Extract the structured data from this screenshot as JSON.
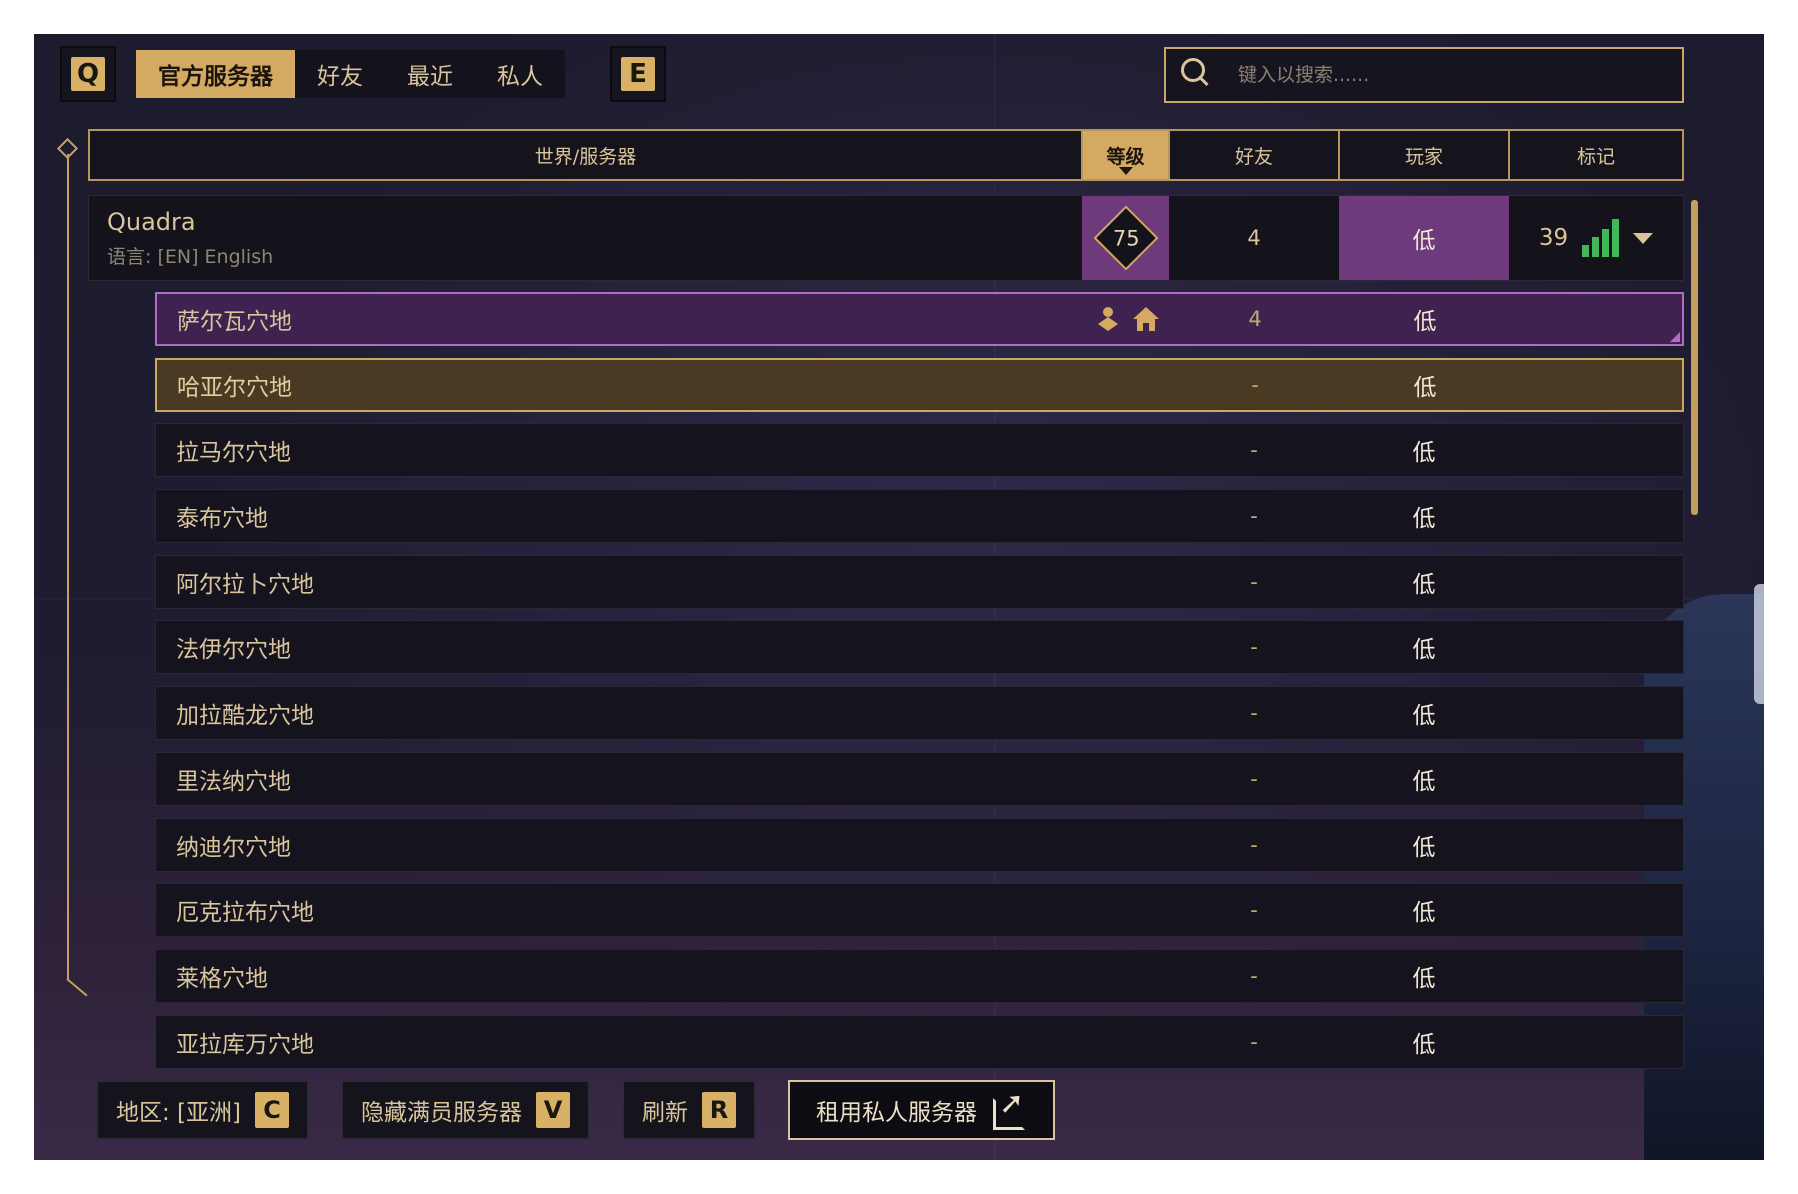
{
  "tabs": {
    "left_key": "Q",
    "right_key": "E",
    "items": [
      {
        "label": "官方服务器",
        "active": true
      },
      {
        "label": "好友",
        "active": false
      },
      {
        "label": "最近",
        "active": false
      },
      {
        "label": "私人",
        "active": false
      }
    ]
  },
  "search": {
    "placeholder": "键入以搜索......",
    "icon": "search-icon"
  },
  "columns": {
    "name": "世界/服务器",
    "level": "等级",
    "friends": "好友",
    "players": "玩家",
    "mark": "标记"
  },
  "world": {
    "name": "Quadra",
    "language": "语言: [EN] English",
    "level": "75",
    "friends": "4",
    "players": "低",
    "ping": "39"
  },
  "servers": [
    {
      "name": "萨尔瓦穴地",
      "friends": "4",
      "players": "低",
      "state": "current",
      "icons": [
        "friends-icon",
        "home-icon"
      ]
    },
    {
      "name": "哈亚尔穴地",
      "friends": "-",
      "players": "低",
      "state": "selected"
    },
    {
      "name": "拉马尔穴地",
      "friends": "-",
      "players": "低",
      "state": ""
    },
    {
      "name": "泰布穴地",
      "friends": "-",
      "players": "低",
      "state": ""
    },
    {
      "name": "阿尔拉卜穴地",
      "friends": "-",
      "players": "低",
      "state": ""
    },
    {
      "name": "法伊尔穴地",
      "friends": "-",
      "players": "低",
      "state": ""
    },
    {
      "name": "加拉酷龙穴地",
      "friends": "-",
      "players": "低",
      "state": ""
    },
    {
      "name": "里法纳穴地",
      "friends": "-",
      "players": "低",
      "state": ""
    },
    {
      "name": "纳迪尔穴地",
      "friends": "-",
      "players": "低",
      "state": ""
    },
    {
      "name": "厄克拉布穴地",
      "friends": "-",
      "players": "低",
      "state": ""
    },
    {
      "name": "莱格穴地",
      "friends": "-",
      "players": "低",
      "state": ""
    },
    {
      "name": "亚拉库万穴地",
      "friends": "-",
      "players": "低",
      "state": ""
    }
  ],
  "footer": {
    "region": {
      "label": "地区: [亚洲]",
      "key": "C"
    },
    "hide_full": {
      "label": "隐藏满员服务器",
      "key": "V"
    },
    "refresh": {
      "label": "刷新",
      "key": "R"
    },
    "rent": {
      "label": "租用私人服务器"
    }
  },
  "colors": {
    "accent_gold": "#d4aa62",
    "current_purple": "#6e3a7c",
    "signal_green": "#43b65a"
  }
}
